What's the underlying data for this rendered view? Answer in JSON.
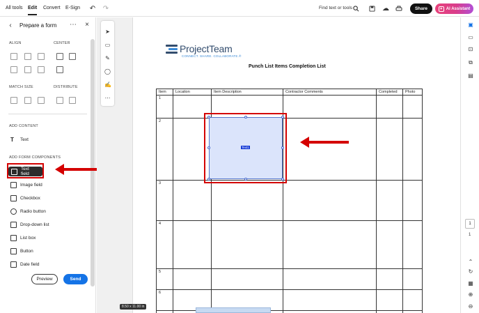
{
  "topbar": {
    "tabs": [
      "All tools",
      "Edit",
      "Convert",
      "E-Sign"
    ],
    "active_tab": "Edit",
    "search_label": "Find text or tools",
    "share_label": "Share",
    "ai_label": "AI Assistant"
  },
  "panel": {
    "title": "Prepare a form",
    "align_label": "ALIGN",
    "center_label": "CENTER",
    "match_size_label": "MATCH SIZE",
    "distribute_label": "DISTRIBUTE",
    "add_content_label": "ADD CONTENT",
    "text_item": "Text",
    "add_form_label": "ADD FORM COMPONENTS",
    "components": [
      {
        "label": "Text field",
        "icon": "text-field-icon"
      },
      {
        "label": "Image field",
        "icon": "image-field-icon"
      },
      {
        "label": "Checkbox",
        "icon": "checkbox-icon"
      },
      {
        "label": "Radio button",
        "icon": "radio-button-icon"
      },
      {
        "label": "Drop-down list",
        "icon": "dropdown-list-icon"
      },
      {
        "label": "List box",
        "icon": "list-box-icon"
      },
      {
        "label": "Button",
        "icon": "button-icon"
      },
      {
        "label": "Date field",
        "icon": "date-field-icon"
      }
    ],
    "preview_label": "Preview",
    "send_label": "Send"
  },
  "document": {
    "logo_text": "ProjectTeam",
    "logo_tagline": "CONNECT. SHARE. COLLABORATE.®",
    "title": "Punch List Items Completion List",
    "headers": [
      "Item",
      "Location",
      "Item Description",
      "Contractor Comments",
      "Completed",
      "Photo"
    ],
    "rows": [
      "1",
      "2",
      "3",
      "4",
      "5",
      "6",
      ""
    ],
    "field_label": "Text1",
    "page_size": "8.50 x 11.00 in"
  },
  "navigation": {
    "current_page": "1",
    "total_pages": "1"
  },
  "colors": {
    "accent_blue": "#1473e6",
    "highlight_red": "#d40000",
    "field_fill": "#dbe4fb"
  }
}
